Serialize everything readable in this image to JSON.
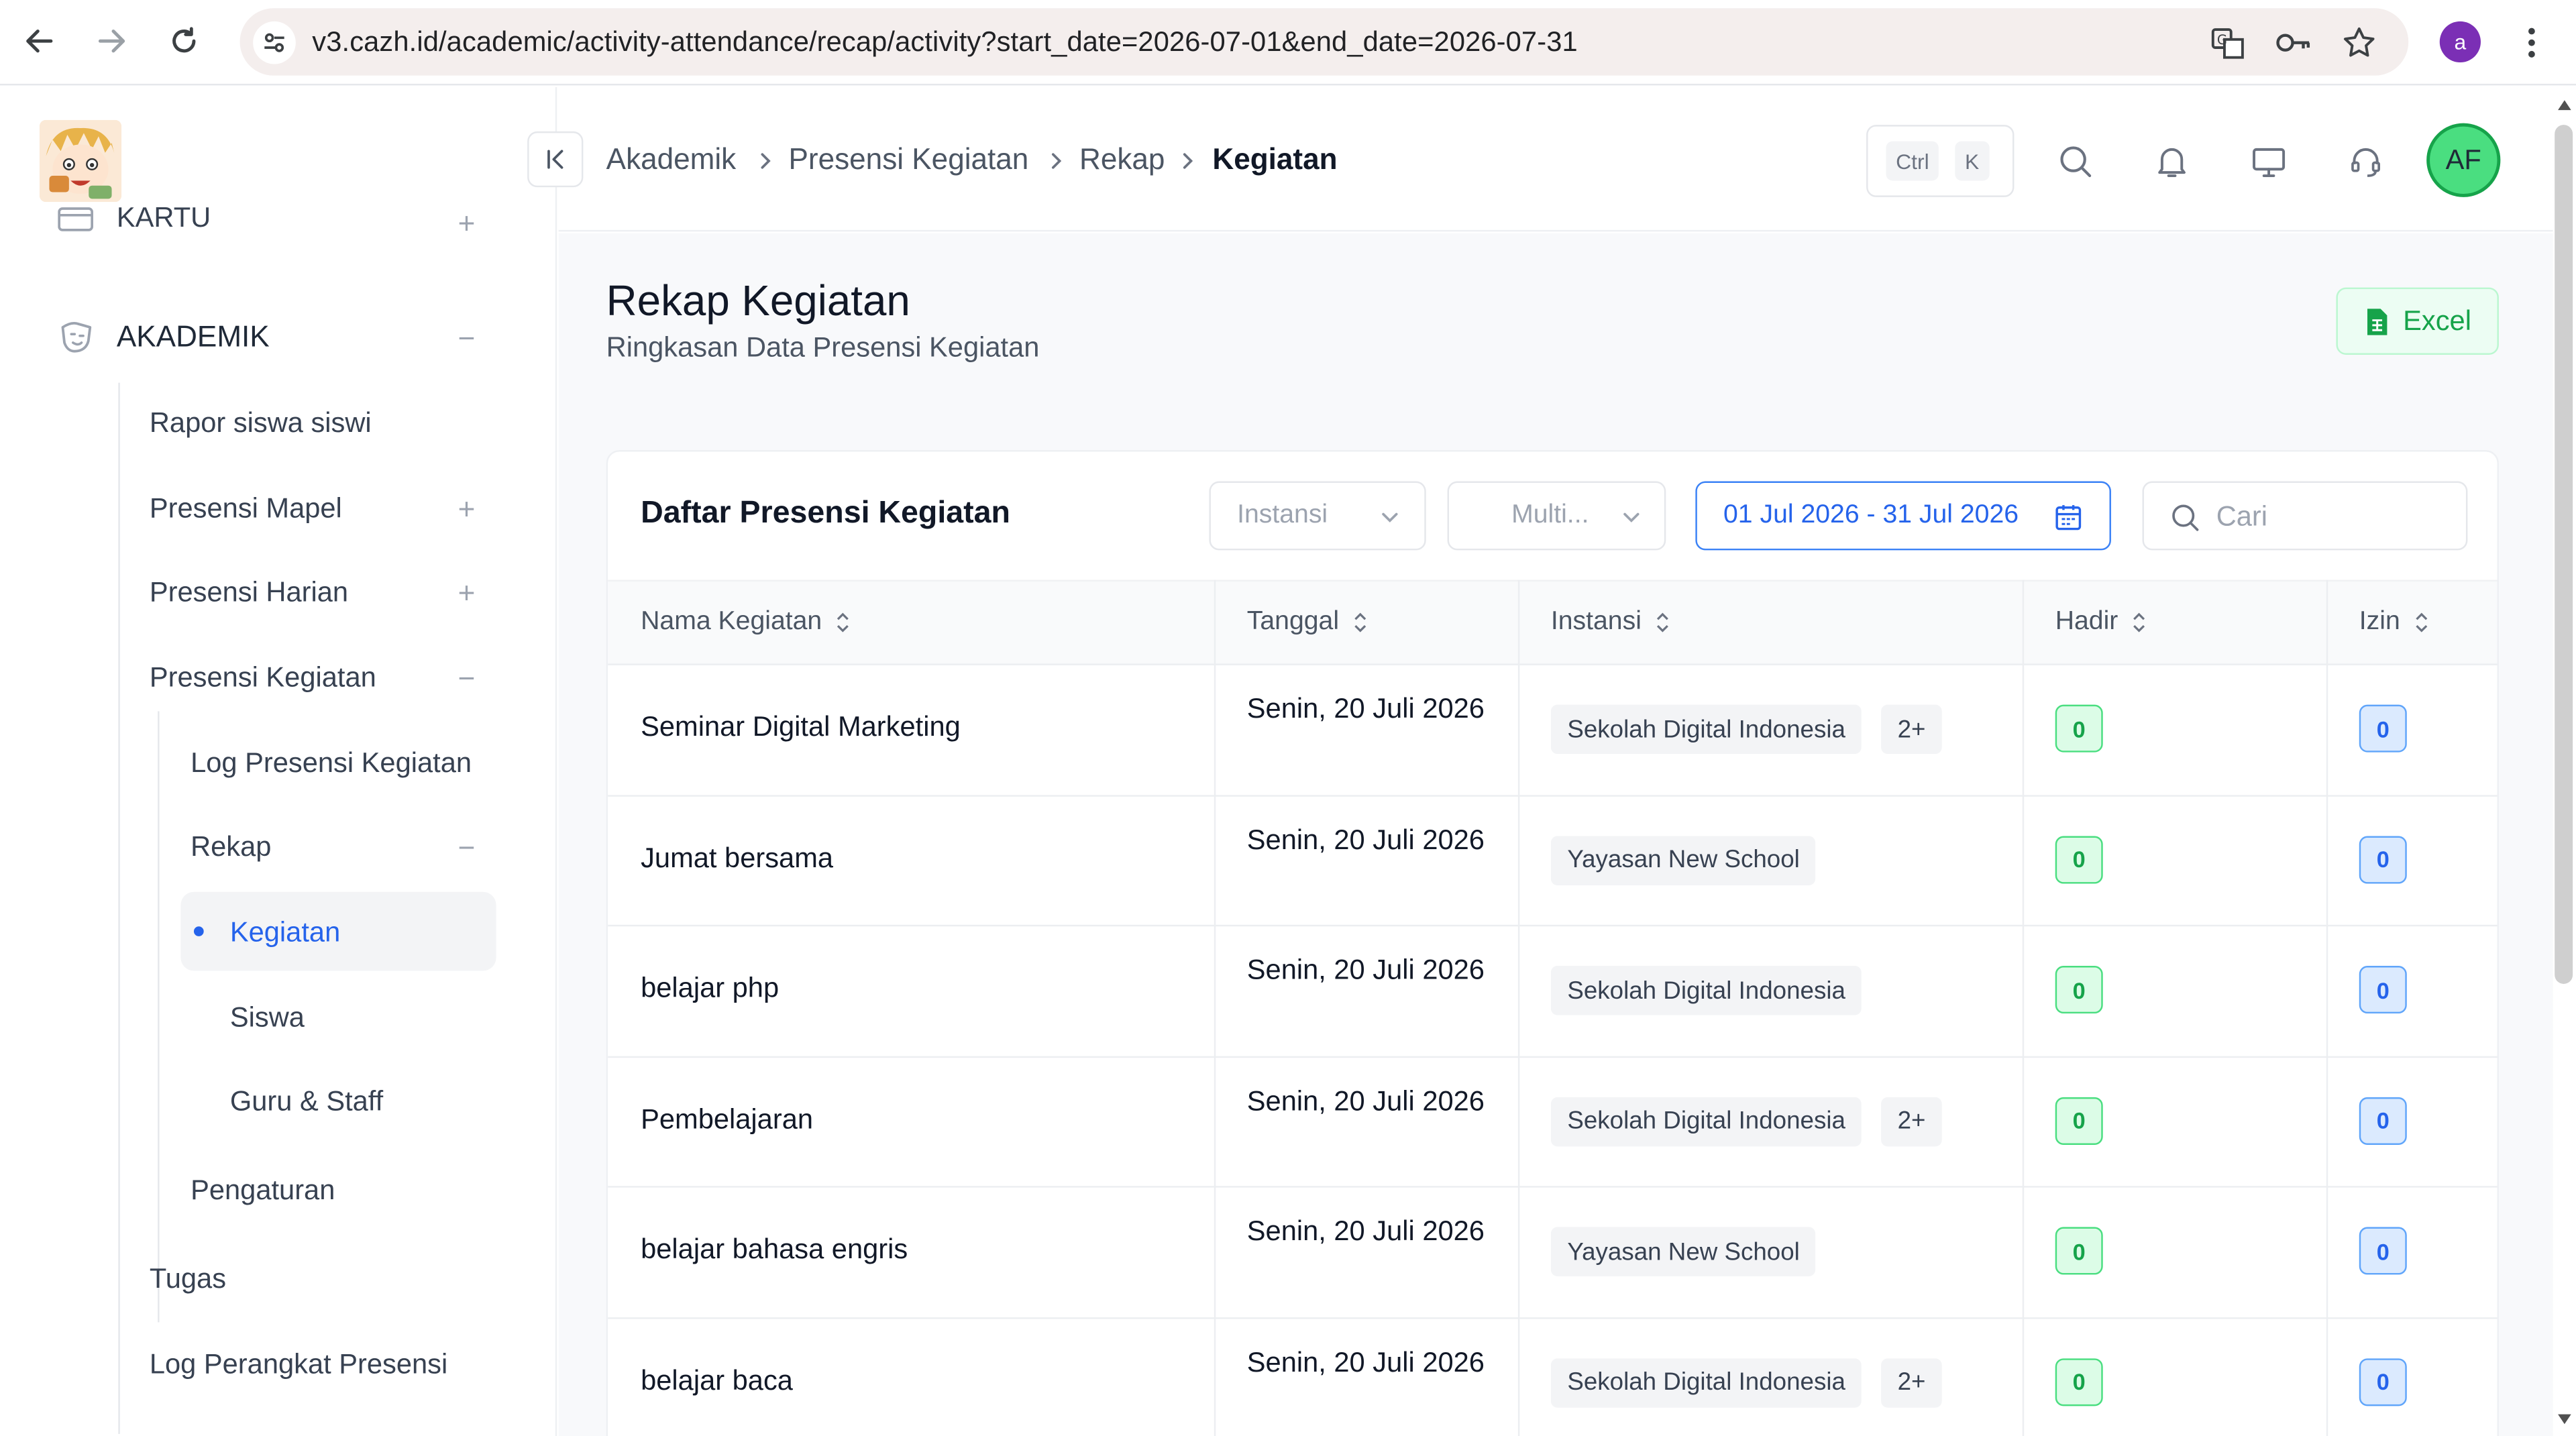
{
  "browser": {
    "url": "v3.cazh.id/academic/activity-attendance/recap/activity?start_date=2026-07-01&end_date=2026-07-31",
    "profile_initial": "a"
  },
  "sidebar": {
    "cut_section": "KARTU",
    "section": "AKADEMIK",
    "items": [
      {
        "label": "Rapor siswa siswi"
      },
      {
        "label": "Presensi Mapel",
        "sign": "+"
      },
      {
        "label": "Presensi Harian",
        "sign": "+"
      },
      {
        "label": "Presensi Kegiatan",
        "sign": "−"
      },
      {
        "label": "Log Presensi Kegiatan"
      },
      {
        "label": "Rekap",
        "sign": "−"
      },
      {
        "label": "Kegiatan"
      },
      {
        "label": "Siswa"
      },
      {
        "label": "Guru & Staff"
      },
      {
        "label": "Pengaturan"
      },
      {
        "label": "Tugas"
      },
      {
        "label": "Log Perangkat Presensi"
      }
    ],
    "section_sign": "−",
    "cut_sign": "+"
  },
  "header": {
    "breadcrumb": [
      "Akademik",
      "Presensi Kegiatan",
      "Rekap",
      "Kegiatan"
    ],
    "shortcut": [
      "Ctrl",
      "K"
    ],
    "avatar": "AF"
  },
  "page": {
    "title": "Rekap Kegiatan",
    "subtitle": "Ringkasan Data Presensi Kegiatan",
    "excel_label": "Excel"
  },
  "card": {
    "title": "Daftar Presensi Kegiatan",
    "filter_instansi": "Instansi",
    "filter_multi": "Multi...",
    "date_range": "01 Jul 2026 - 31 Jul 2026",
    "search_placeholder": "Cari",
    "columns": [
      "Nama Kegiatan",
      "Tanggal",
      "Instansi",
      "Hadir",
      "Izin"
    ],
    "rows": [
      {
        "name": "Seminar Digital Marketing",
        "date": "Senin, 20 Juli 2026",
        "instansi": "Sekolah Digital Indonesia",
        "more": "2+",
        "hadir": "0",
        "izin": "0"
      },
      {
        "name": "Jumat bersama",
        "date": "Senin, 20 Juli 2026",
        "instansi": "Yayasan New School",
        "more": "",
        "hadir": "0",
        "izin": "0"
      },
      {
        "name": "belajar php",
        "date": "Senin, 20 Juli 2026",
        "instansi": "Sekolah Digital Indonesia",
        "more": "",
        "hadir": "0",
        "izin": "0"
      },
      {
        "name": "Pembelajaran",
        "date": "Senin, 20 Juli 2026",
        "instansi": "Sekolah Digital Indonesia",
        "more": "2+",
        "hadir": "0",
        "izin": "0"
      },
      {
        "name": "belajar bahasa engris",
        "date": "Senin, 20 Juli 2026",
        "instansi": "Yayasan New School",
        "more": "",
        "hadir": "0",
        "izin": "0"
      },
      {
        "name": "belajar baca",
        "date": "Senin, 20 Juli 2026",
        "instansi": "Sekolah Digital Indonesia",
        "more": "2+",
        "hadir": "0",
        "izin": "0"
      }
    ]
  },
  "colors": {
    "accent": "#2563eb",
    "success": "#16a34a",
    "avatar_bg": "#4ade80",
    "profile_chip": "#7b2fb5"
  }
}
